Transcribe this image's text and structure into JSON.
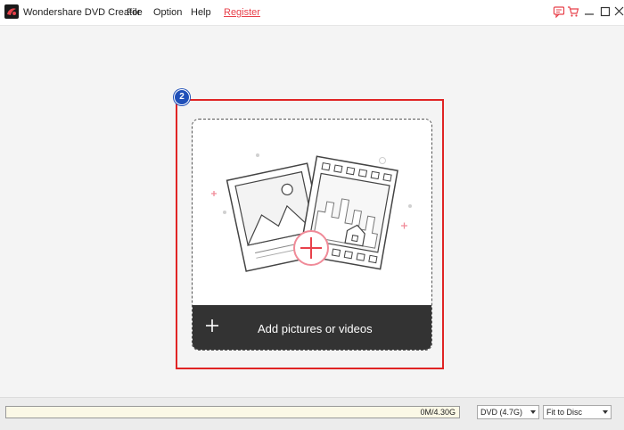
{
  "app": {
    "title": "Wondershare DVD Creator"
  },
  "menu": {
    "file": "File",
    "option": "Option",
    "help": "Help",
    "register": "Register"
  },
  "workspace": {
    "step_number": "2",
    "add_label": "Add pictures or videos"
  },
  "status": {
    "capacity": "0M/4.30G",
    "disc_type": "DVD (4.7G)",
    "fit_mode": "Fit to Disc"
  },
  "colors": {
    "accent": "#e8414b",
    "highlight": "#e02424",
    "badge": "#1f4fb8",
    "add_bar": "#333333"
  }
}
